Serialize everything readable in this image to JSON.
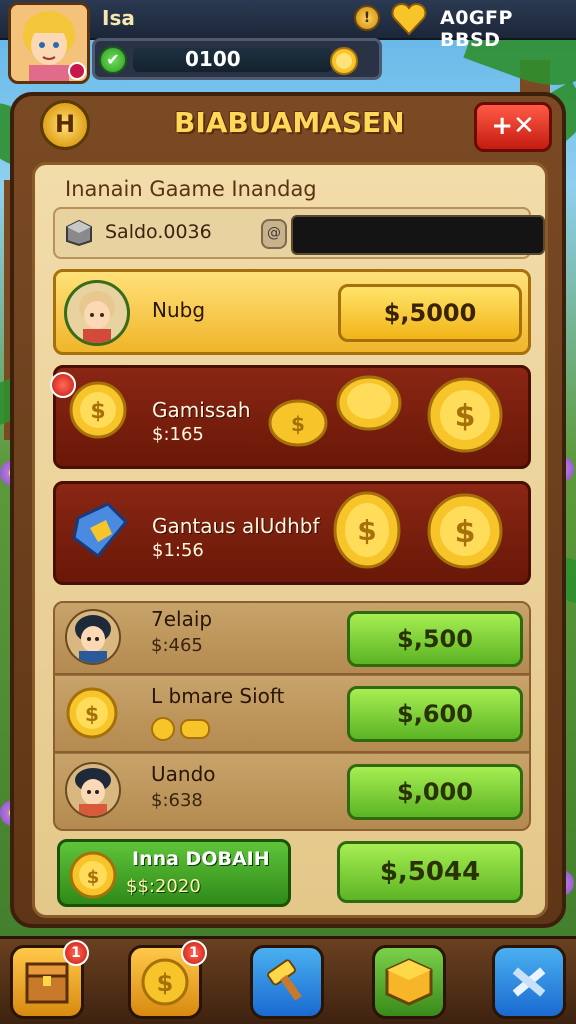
{
  "topbar": {
    "player_name": "Isa",
    "xp_value": "0100",
    "currency_text": "A0GFP BBSD",
    "info_icon": "!"
  },
  "panel": {
    "title": "BIABUAMASEN",
    "help_label": "H",
    "close_label": "+✕",
    "subtitle": "Inanain Gaame Inandag",
    "saldo_label": "Saldo.0036",
    "saldo_lock": "@"
  },
  "offers": [
    {
      "name": "Nubg",
      "price": "$,5000"
    },
    {
      "name": "Gamissah",
      "sub": "$:165"
    },
    {
      "name": "Gantaus alUdhbf",
      "sub": "$1:56"
    }
  ],
  "characters": [
    {
      "name": "7elaip",
      "sub": "$:465",
      "price": "$,500"
    },
    {
      "name": "L bmare Sioft",
      "sub": "",
      "price": "$,600"
    },
    {
      "name": "Uando",
      "sub": "$:638",
      "price": "$,000"
    }
  ],
  "bottom_offer": {
    "title": "Inna DOBAIH",
    "sub": "$$:2020",
    "price": "$,5044"
  },
  "nav": [
    {
      "icon": "chest-icon",
      "badge": "1"
    },
    {
      "icon": "coin-icon",
      "badge": "1"
    },
    {
      "icon": "hammer-icon",
      "badge": ""
    },
    {
      "icon": "box-icon",
      "badge": ""
    },
    {
      "icon": "tools-icon",
      "badge": ""
    }
  ],
  "colors": {
    "panel_brown": "#6a3c1a",
    "gold": "#f2b418",
    "green": "#5cb424",
    "red": "#c41c10"
  }
}
